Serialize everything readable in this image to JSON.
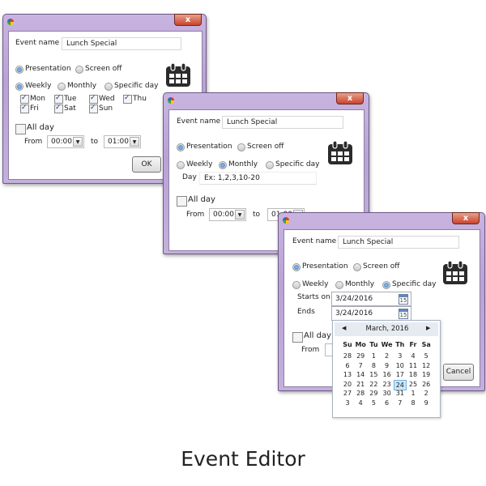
{
  "windows": [
    {
      "close_label": "x",
      "event_name_label": "Event name",
      "event_name_value": "Lunch Special",
      "presentation_label": "Presentation",
      "screen_off_label": "Screen off",
      "weekly_label": "Weekly",
      "monthly_label": "Monthly",
      "specific_day_label": "Specific day",
      "days": [
        "Mon",
        "Tue",
        "Wed",
        "Thu",
        "Fri",
        "Sat",
        "Sun"
      ],
      "all_day_label": "All day",
      "from_label": "From",
      "from_value": "00:00",
      "to_label": "to",
      "to_value": "01:00",
      "ok_label": "OK"
    },
    {
      "close_label": "x",
      "event_name_label": "Event name",
      "event_name_value": "Lunch Special",
      "presentation_label": "Presentation",
      "screen_off_label": "Screen off",
      "weekly_label": "Weekly",
      "monthly_label": "Monthly",
      "specific_day_label": "Specific day",
      "day_label": "Day",
      "day_placeholder": "Ex: 1,2,3,10-20",
      "all_day_label": "All day",
      "from_label": "From",
      "from_value": "00:00",
      "to_label": "to",
      "to_value": "01:00"
    },
    {
      "close_label": "x",
      "event_name_label": "Event name",
      "event_name_value": "Lunch Special",
      "presentation_label": "Presentation",
      "screen_off_label": "Screen off",
      "weekly_label": "Weekly",
      "monthly_label": "Monthly",
      "specific_day_label": "Specific day",
      "starts_on_label": "Starts on",
      "starts_on_value": "3/24/2016",
      "ends_label": "Ends",
      "ends_value": "3/24/2016",
      "calendar_icon_text": "15",
      "all_day_label": "All day",
      "from_label": "From",
      "cancel_label": "Cancel"
    }
  ],
  "calendar_popup": {
    "month_label": "March, 2016",
    "prev_icon": "◀",
    "next_icon": "▶",
    "weekdays": [
      "Su",
      "Mo",
      "Tu",
      "We",
      "Th",
      "Fr",
      "Sa"
    ],
    "weeks": [
      [
        "28",
        "29",
        "1",
        "2",
        "3",
        "4",
        "5"
      ],
      [
        "6",
        "7",
        "8",
        "9",
        "10",
        "11",
        "12"
      ],
      [
        "13",
        "14",
        "15",
        "16",
        "17",
        "18",
        "19"
      ],
      [
        "20",
        "21",
        "22",
        "23",
        "24",
        "25",
        "26"
      ],
      [
        "27",
        "28",
        "29",
        "30",
        "31",
        "1",
        "2"
      ],
      [
        "3",
        "4",
        "5",
        "6",
        "7",
        "8",
        "9"
      ]
    ],
    "selected_day": "24"
  },
  "caption": "Event Editor",
  "colors": {
    "frame": "#c3b0dc",
    "close": "#c9442c",
    "radio_selected": "#2a7cc8",
    "selected_day": "#cbe5f7"
  }
}
